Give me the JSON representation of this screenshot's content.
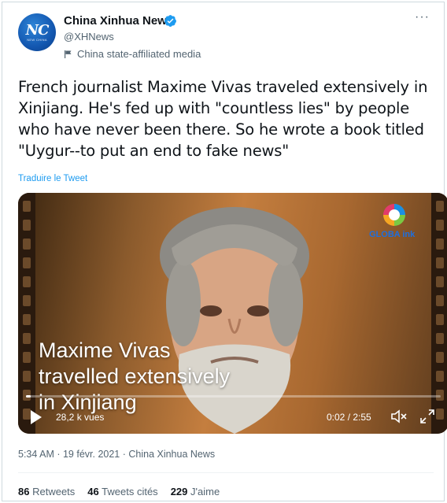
{
  "author": {
    "name": "China Xinhua News",
    "handle": "@XHNews",
    "affiliation": "China state-affiliated media",
    "avatar_text": "NC",
    "avatar_subtext": "NEW CHINA"
  },
  "tweet": {
    "text": "French journalist Maxime Vivas traveled extensively in Xinjiang. He's fed up with \"countless lies\" by people who have never been there. So he wrote a book titled \"Uygur--to put an end to fake news\"",
    "translate_label": "Traduire le Tweet"
  },
  "video": {
    "caption_line1": "Maxime Vivas",
    "caption_line2": "travelled extensively",
    "caption_line3": "in Xinjiang",
    "watermark": "GLOBA  ink",
    "views": "28,2 k vues",
    "time": "0:02 / 2:55",
    "progress": 0.011
  },
  "meta": {
    "timestamp": "5:34 AM · 19 févr. 2021 · China Xinhua News"
  },
  "stats": {
    "retweets_count": "86",
    "retweets_label": "Retweets",
    "quotes_count": "46",
    "quotes_label": "Tweets cités",
    "likes_count": "229",
    "likes_label": "J'aime"
  },
  "icons": {
    "verified": "verified-badge-icon",
    "more": "more-options-icon",
    "affiliation": "state-media-flag-icon",
    "play": "play-icon",
    "mute": "mute-icon",
    "fullscreen": "fullscreen-icon"
  },
  "colors": {
    "accent": "#1d9bf0",
    "secondary_text": "#536471"
  }
}
